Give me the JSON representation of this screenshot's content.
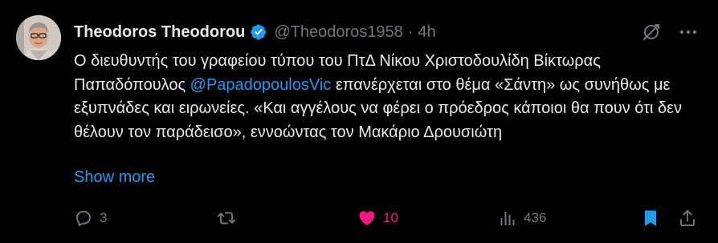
{
  "tweet": {
    "author": {
      "display_name": "Theodoros Theodorou",
      "handle": "@Theodoros1958",
      "verified": true,
      "avatar_icon": "profile-photo"
    },
    "separator": "·",
    "time": "4h",
    "text": {
      "part1": "Ο διευθυντής του γραφείου τύπου του ΠτΔ Νίκου Χριστοδουλίδη Βίκτωρας Παπαδόπουλος ",
      "mention": "@PapadopoulosVic",
      "part2": " επανέρχεται στο θέμα «Σάντη» ως συνήθως με εξυπνάδες και ειρωνείες.  «Και αγγέλους να φέρει ο πρόεδρος κάποιοι θα πουν ότι δεν θέλουν τον παράδεισο», εννοώντας τον Μακάριο Δρουσιώτη"
    },
    "show_more": "Show more",
    "stats": {
      "replies": "3",
      "retweets": "",
      "likes": "10",
      "views": "436"
    },
    "state": {
      "liked": true,
      "bookmarked": true
    }
  },
  "colors": {
    "background": "#000000",
    "text": "#e7e9ea",
    "secondary": "#71767b",
    "accent": "#1d9bf0",
    "like": "#f91880"
  }
}
